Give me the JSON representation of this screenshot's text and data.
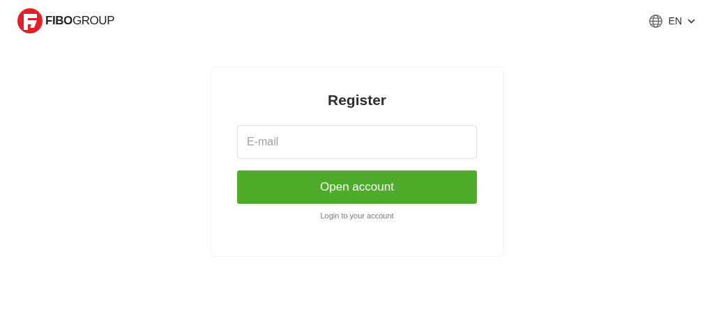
{
  "header": {
    "logo_text": "**FIBO**GROUP",
    "language": "EN"
  },
  "form": {
    "title": "Register",
    "email": {
      "placeholder": "E-mail"
    },
    "submit": "Open account",
    "login_link": "Login to your account"
  }
}
